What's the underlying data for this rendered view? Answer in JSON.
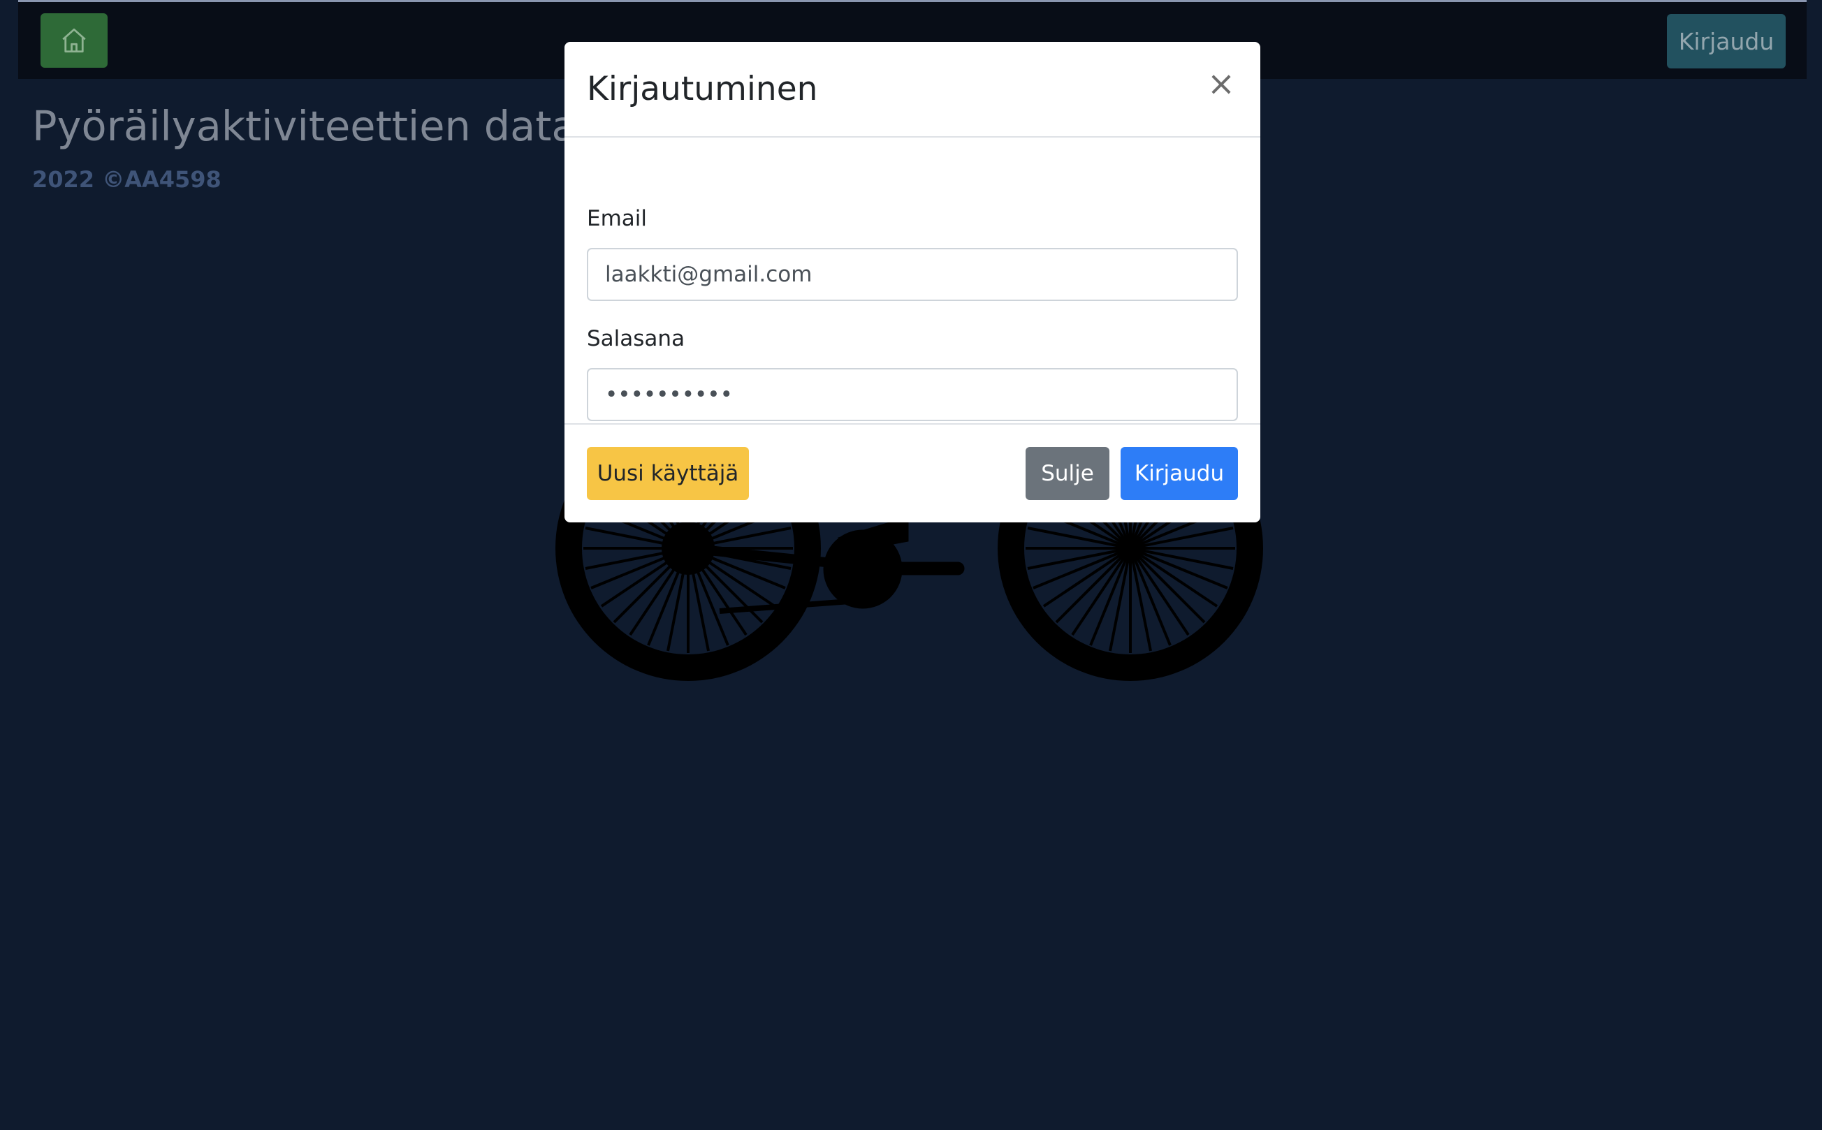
{
  "navbar": {
    "home_icon": "home-icon",
    "login_label": "Kirjaudu"
  },
  "page": {
    "title": "Pyöräilyaktiviteettien data-an",
    "copyright": "2022 ©AA4598"
  },
  "modal": {
    "title": "Kirjautuminen",
    "close_symbol": "×",
    "email_label": "Email",
    "email_value": "laakkti@gmail.com",
    "password_label": "Salasana",
    "password_value": "••••••••••",
    "new_user_label": "Uusi käyttäjä",
    "close_label": "Sulje",
    "login_label": "Kirjaudu"
  },
  "colors": {
    "background": "#0f1b2e",
    "navbar": "#080d17",
    "home_button": "#2e6a37",
    "nav_login_button": "#22515f",
    "new_user_button": "#f7c545",
    "close_button": "#6b737b",
    "login_button": "#2d7df7"
  }
}
